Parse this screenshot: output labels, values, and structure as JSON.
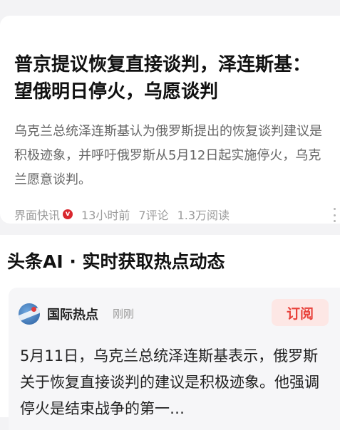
{
  "article": {
    "headline": "普京提议恢复直接谈判，泽连斯基：望俄明日停火，乌愿谈判",
    "summary": "乌克兰总统泽连斯基认为俄罗斯提出的恢复谈判建议是积极迹象，并呼吁俄罗斯从5月12日起实施停火，乌克兰愿意谈判。",
    "source": "界面快讯",
    "verified_badge": "v",
    "time": "13小时前",
    "comments": "7评论",
    "reads": "1.3万阅读"
  },
  "ai_section": {
    "title": "头条AI · 实时获取热点动态",
    "account_name": "国际热点",
    "account_time": "刚刚",
    "subscribe_label": "订阅",
    "body": "5月11日，乌克兰总统泽连斯基表示，俄罗斯关于恢复直接谈判的建议是积极迹象。他强调停火是结束战争的第一…"
  },
  "colors": {
    "background": "#f3f3f5",
    "accent": "#e8413a",
    "subscribe_bg": "#fde7e5",
    "muted_text": "#9b9b9b"
  },
  "icons": [
    "verified-badge-icon",
    "more-options-icon",
    "account-avatar-icon"
  ]
}
